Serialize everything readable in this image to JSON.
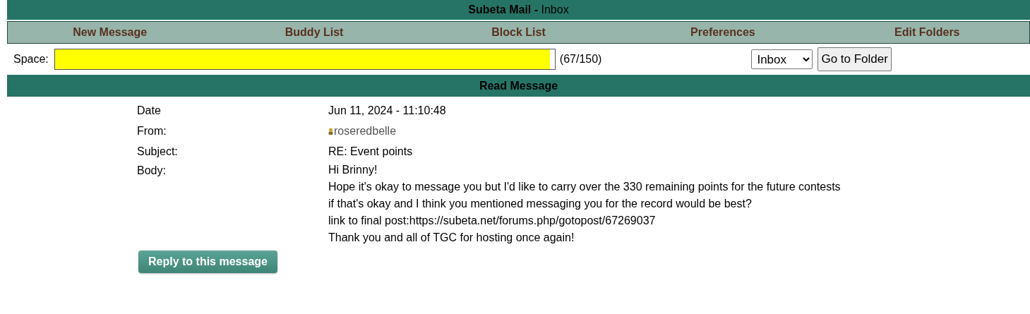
{
  "header": {
    "title": "Subeta Mail -",
    "section": "Inbox"
  },
  "nav": [
    "New Message",
    "Buddy List",
    "Block List",
    "Preferences",
    "Edit Folders"
  ],
  "space": {
    "label": "Space:",
    "level": 0.99,
    "reading": "(67/150)"
  },
  "folder_select": {
    "value": "Inbox"
  },
  "go_button": "Go to Folder",
  "read_header": "Read Message",
  "fields": [
    {
      "label": "Date",
      "value": "Jun 11, 2024 - 11:10:48"
    },
    {
      "label": "From:",
      "value": "roseredbelle",
      "kind": "user"
    },
    {
      "label": "Subject:",
      "value": "RE: Event points"
    }
  ],
  "body": {
    "label": "Body:",
    "lines": [
      "Hi Brinny!",
      "Hope it's okay to message you but I'd like to carry over the 330 remaining points for the future contests",
      "if that's okay and I think you mentioned messaging you for the record would be best?",
      "link to final post:https://subeta.net/forums.php/gotopost/67269037",
      "Thank you and all of TGC for hosting once again!"
    ]
  },
  "reply_button": "Reply to this message"
}
